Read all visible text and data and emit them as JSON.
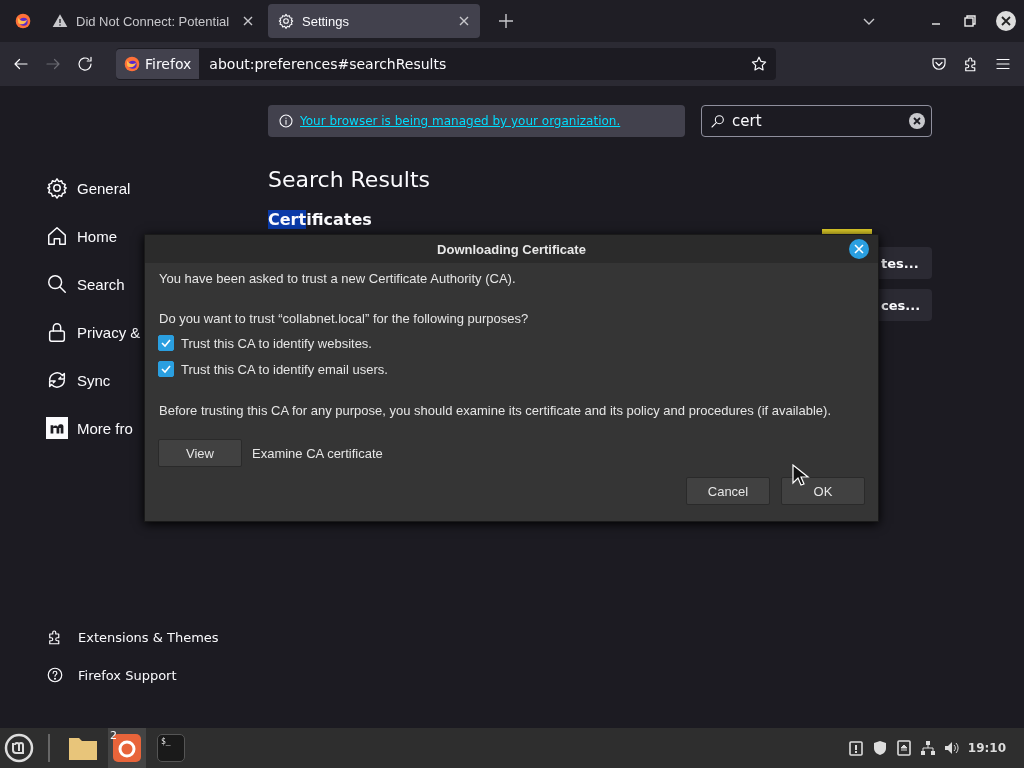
{
  "tabs": [
    {
      "title": "Did Not Connect: Potential",
      "kind": "warning",
      "selected": false
    },
    {
      "title": "Settings",
      "kind": "settings",
      "selected": true
    }
  ],
  "toolbar": {
    "identity": "Firefox",
    "url": "about:preferences#searchResults",
    "forward_disabled": true
  },
  "notice": {
    "link": "Your browser is being managed by your organization."
  },
  "search": {
    "value": "cert"
  },
  "sidebar": {
    "items": [
      {
        "label": "General",
        "kind": "gear",
        "selected": false
      },
      {
        "label": "Home",
        "kind": "home",
        "selected": false
      },
      {
        "label": "Search",
        "kind": "search",
        "selected": false
      },
      {
        "label": "Privacy &",
        "kind": "lock",
        "selected": false
      },
      {
        "label": "Sync",
        "kind": "sync",
        "selected": false
      },
      {
        "label": "More fro",
        "kind": "m",
        "selected": false
      }
    ],
    "footer": [
      {
        "label": "Extensions & Themes",
        "kind": "puzzle"
      },
      {
        "label": "Firefox Support",
        "kind": "help"
      }
    ]
  },
  "results": {
    "title": "Search Results",
    "section": {
      "match": "Cert",
      "rest": "ificates"
    },
    "buttons": [
      "tes...",
      "ces..."
    ]
  },
  "dialog": {
    "title": "Downloading Certificate",
    "intro": "You have been asked to trust a new Certificate Authority (CA).",
    "question": "Do you want to trust “collabnet.local” for the following purposes?",
    "options": [
      {
        "label": "Trust this CA to identify websites.",
        "checked": true
      },
      {
        "label": "Trust this CA to identify email users.",
        "checked": true
      }
    ],
    "advice": "Before trusting this CA for any purpose, you should examine its certificate and its policy and procedures (if available).",
    "view_button": "View",
    "view_label": "Examine CA certificate",
    "buttons": [
      "Cancel",
      "OK"
    ]
  },
  "taskbar": {
    "apps": [
      {
        "kind": "folder",
        "active": false
      },
      {
        "kind": "firefox",
        "active": true,
        "badge": "2"
      },
      {
        "kind": "terminal",
        "active": false,
        "glyph": "$_"
      }
    ],
    "clock": "19:10"
  }
}
